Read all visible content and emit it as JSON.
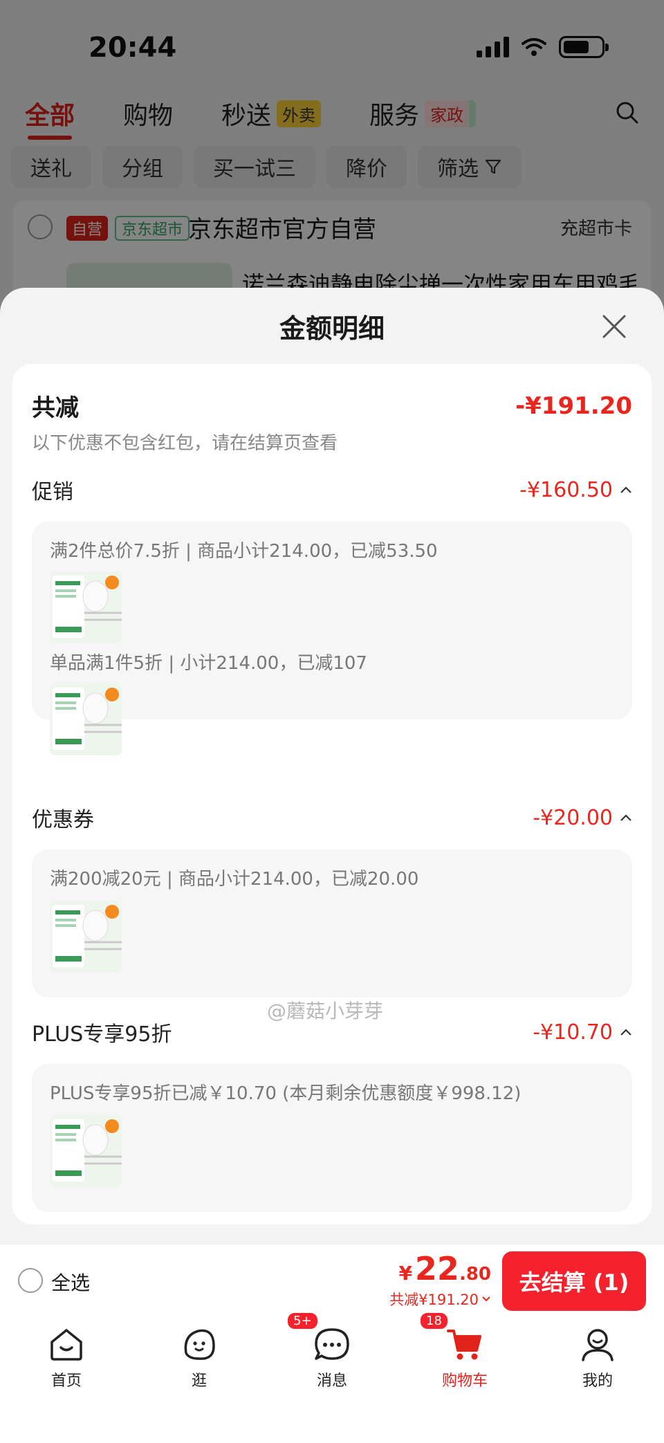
{
  "status_bar": {
    "time": "20:44"
  },
  "top_tabs": [
    {
      "label": "全部",
      "badge": ""
    },
    {
      "label": "购物",
      "badge": ""
    },
    {
      "label": "秒送",
      "badge": "外卖"
    },
    {
      "label": "服务",
      "badge": "家政"
    }
  ],
  "filters": [
    "送礼",
    "分组",
    "买一试三",
    "降价",
    "筛选"
  ],
  "shop": {
    "tag_self": "自营",
    "tag_jd": "京东超市",
    "name": "京东超市官方自营",
    "card_link": "充超市卡",
    "product_title": "诺兰森迪静电除尘掸一次性家用车用鸡毛"
  },
  "sheet": {
    "title": "金额明细",
    "total_label": "共减",
    "total_value": "-¥191.20",
    "note": "以下优惠不包含红包，请在结算页查看",
    "sections": [
      {
        "label": "促销",
        "value": "-¥160.50",
        "lines": [
          "满2件总价7.5折 | 商品小计214.00，已减53.50",
          "单品满1件5折 | 小计214.00，已减107"
        ]
      },
      {
        "label": "优惠券",
        "value": "-¥20.00",
        "lines": [
          "满200减20元 | 商品小计214.00，已减20.00"
        ]
      },
      {
        "label": "PLUS专享95折",
        "value": "-¥10.70",
        "lines": [
          "PLUS专享95折已减￥10.70 (本月剩余优惠额度￥998.12)"
        ]
      }
    ],
    "watermark": "@蘑菇小芽芽"
  },
  "checkout": {
    "select_all": "全选",
    "price_yen": "¥",
    "price_int": "22",
    "price_dec": ".80",
    "saved": "共减¥191.20",
    "button": "去结算 (1)"
  },
  "nav": [
    {
      "label": "首页",
      "icon": "home-icon",
      "badge": ""
    },
    {
      "label": "逛",
      "icon": "browse-face-icon",
      "badge": ""
    },
    {
      "label": "消息",
      "icon": "message-icon",
      "badge": "5+"
    },
    {
      "label": "购物车",
      "icon": "cart-icon",
      "badge": "18"
    },
    {
      "label": "我的",
      "icon": "profile-icon",
      "badge": ""
    }
  ],
  "colors": {
    "accent": "#e2231a",
    "price": "#e8261e",
    "checkout_button": "#f5222d"
  }
}
